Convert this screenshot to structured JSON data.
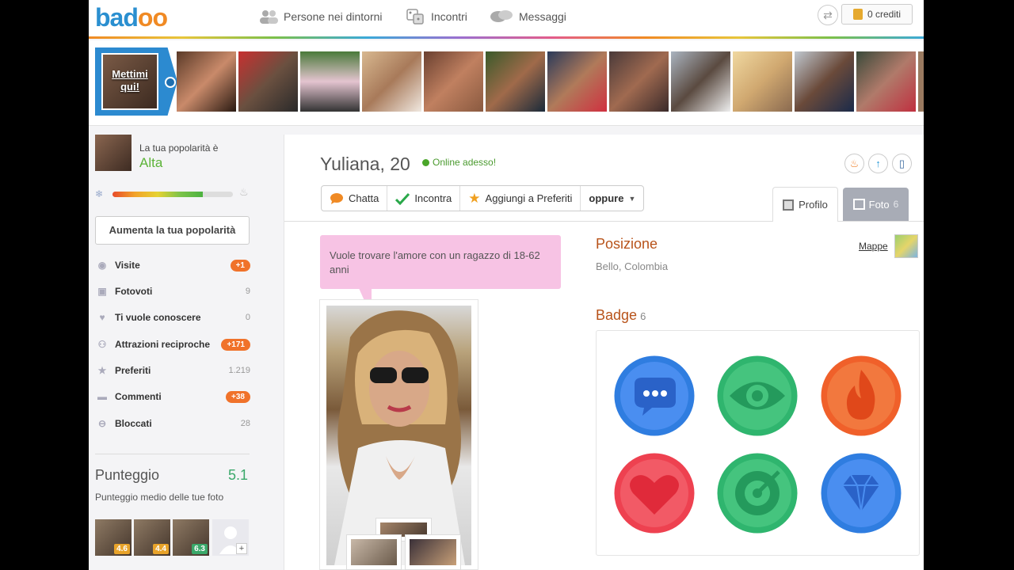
{
  "header": {
    "logo": "badoo",
    "nav": [
      {
        "label": "Persone nei dintorni",
        "icon": "people-icon"
      },
      {
        "label": "Incontri",
        "icon": "dice-icon"
      },
      {
        "label": "Messaggi",
        "icon": "chat-bubbles-icon"
      }
    ],
    "credits_label": "0 crediti"
  },
  "strip": {
    "cta_label": "Mettimi qui!",
    "thumbnails": 12
  },
  "sidebar": {
    "popularity_label": "La tua popolarità è",
    "popularity_value": "Alta",
    "popularity_level": 0.75,
    "boost_button": "Aumenta la tua popolarità",
    "stats": [
      {
        "label": "Visite",
        "icon": "eye-icon",
        "value": "+1",
        "highlight": true
      },
      {
        "label": "Fotovoti",
        "icon": "camera-icon",
        "value": "9",
        "highlight": false
      },
      {
        "label": "Ti vuole conoscere",
        "icon": "heart-icon",
        "value": "0",
        "highlight": false
      },
      {
        "label": "Attrazioni reciproche",
        "icon": "two-people-icon",
        "value": "+171",
        "highlight": true
      },
      {
        "label": "Preferiti",
        "icon": "star-icon",
        "value": "1.219",
        "highlight": false
      },
      {
        "label": "Commenti",
        "icon": "comment-icon",
        "value": "+38",
        "highlight": true
      },
      {
        "label": "Bloccati",
        "icon": "block-icon",
        "value": "28",
        "highlight": false
      }
    ],
    "score_title": "Punteggio",
    "score_value": "5.1",
    "score_subtitle": "Punteggio medio delle tue foto",
    "photo_scores": [
      "4.6",
      "4.4",
      "6.3"
    ]
  },
  "profile": {
    "name": "Yuliana, 20",
    "online_label": "Online adesso!",
    "actions": [
      {
        "label": "Chatta",
        "icon": "chat-icon"
      },
      {
        "label": "Incontra",
        "icon": "check-icon"
      },
      {
        "label": "Aggiungi a Preferiti",
        "icon": "star-icon"
      },
      {
        "label": "oppure",
        "icon": "dropdown-arrow-icon"
      }
    ],
    "tabs": [
      {
        "label": "Profilo",
        "count": ""
      },
      {
        "label": "Foto",
        "count": "6"
      }
    ],
    "bubble_text": "Vuole trovare l'amore con un ragazzo di 18-62 anni",
    "position_title": "Posizione",
    "position_value": "Bello, Colombia",
    "map_link": "Mappe",
    "badge_title": "Badge",
    "badge_count": "6",
    "badges": [
      {
        "name": "chat-badge",
        "color": "#2f7de0"
      },
      {
        "name": "eye-badge",
        "color": "#2fb56e"
      },
      {
        "name": "fire-badge",
        "color": "#f0602a"
      },
      {
        "name": "heart-badge",
        "color": "#ee4150"
      },
      {
        "name": "target-badge",
        "color": "#2fb56e"
      },
      {
        "name": "diamond-badge",
        "color": "#2f7de0"
      }
    ]
  }
}
